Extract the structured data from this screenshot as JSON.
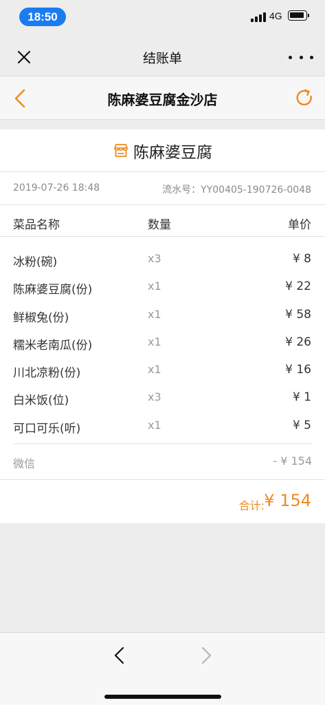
{
  "status_bar": {
    "time": "18:50",
    "network": "4G"
  },
  "wx_nav": {
    "title": "结账单",
    "close_icon": "close-icon",
    "more_icon": "more-icon"
  },
  "store_header": {
    "title": "陈麻婆豆腐金沙店",
    "back_icon": "chevron-left-icon",
    "refresh_icon": "refresh-icon"
  },
  "receipt": {
    "shop_name": "陈麻婆豆腐",
    "shop_icon": "storefront-icon",
    "date": "2019-07-26 18:48",
    "serial": "流水号：YY00405-190726-0048",
    "columns": {
      "name": "菜品名称",
      "qty": "数量",
      "price": "单价"
    },
    "items": [
      {
        "name": "冰粉(碗)",
        "qty": "x3",
        "price": "¥ 8"
      },
      {
        "name": "陈麻婆豆腐(份)",
        "qty": "x1",
        "price": "¥ 22"
      },
      {
        "name": "鲜椒兔(份)",
        "qty": "x1",
        "price": "¥ 58"
      },
      {
        "name": "糯米老南瓜(份)",
        "qty": "x1",
        "price": "¥ 26"
      },
      {
        "name": "川北凉粉(份)",
        "qty": "x1",
        "price": "¥ 16"
      },
      {
        "name": "白米饭(位)",
        "qty": "x3",
        "price": "¥ 1"
      },
      {
        "name": "可口可乐(听)",
        "qty": "x1",
        "price": "¥ 5"
      }
    ],
    "payment": {
      "method": "微信",
      "amount": "- ¥ 154"
    },
    "total": {
      "label": "合计:",
      "value": "¥ 154"
    }
  },
  "colors": {
    "accent": "#f08a1d",
    "time_pill": "#1a7cf0"
  }
}
